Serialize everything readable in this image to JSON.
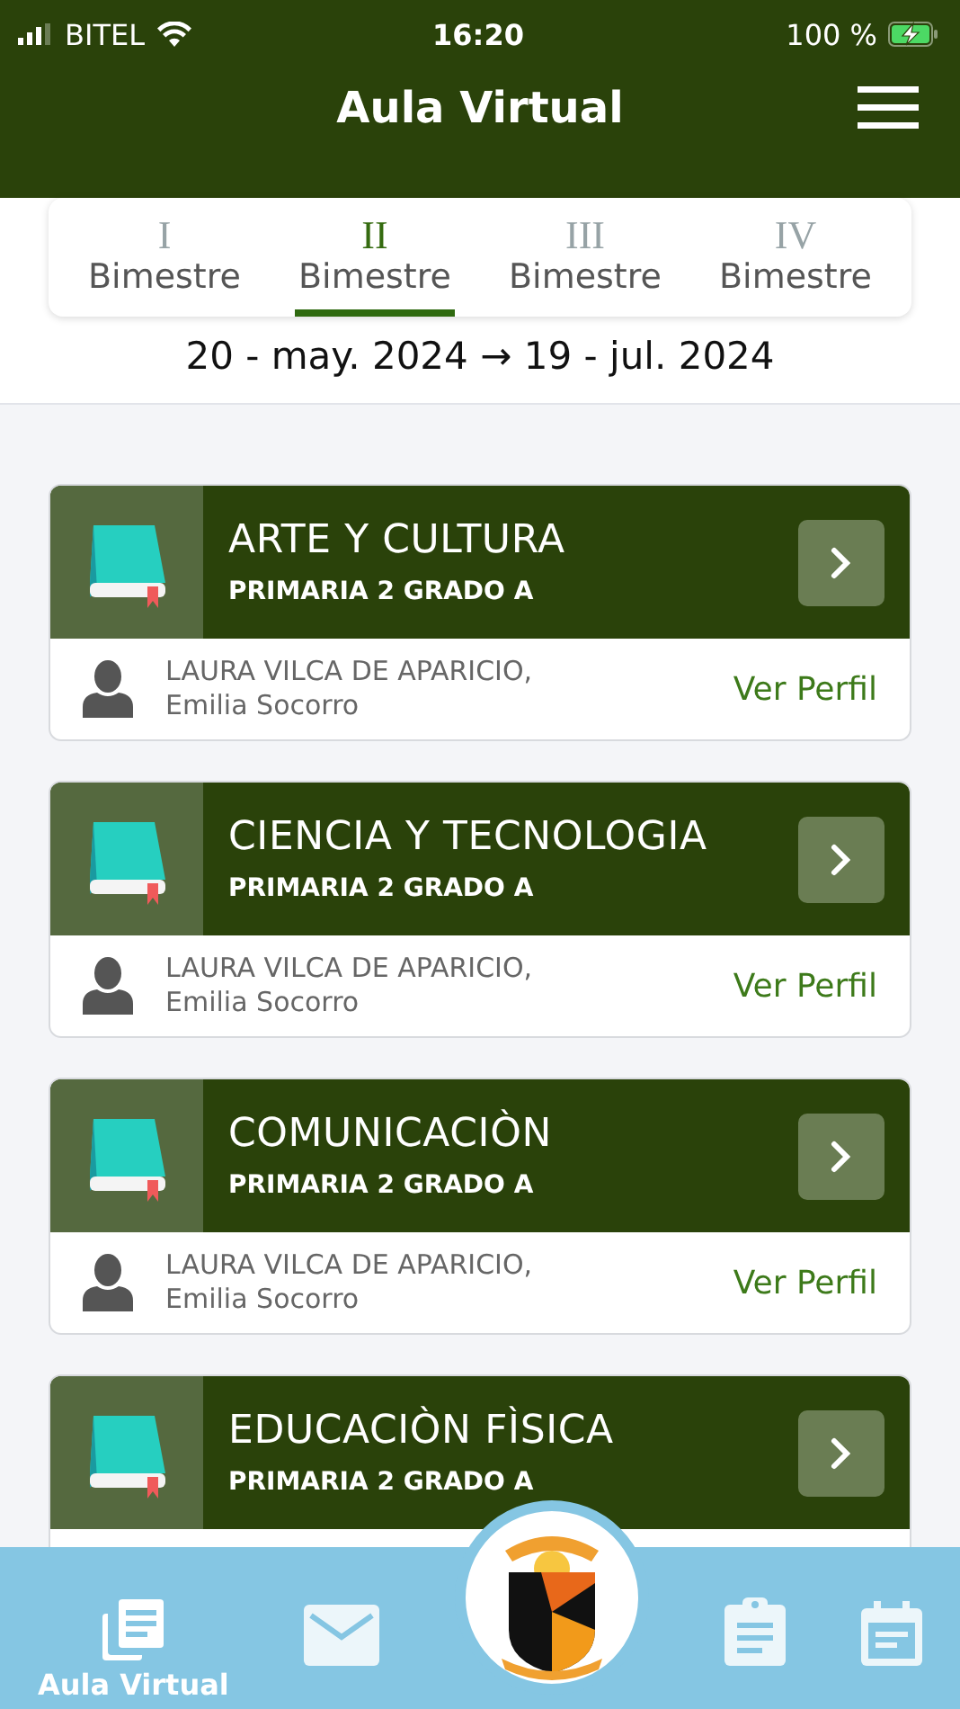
{
  "status_bar": {
    "carrier": "BITEL",
    "time": "16:20",
    "battery": "100 %"
  },
  "header": {
    "title": "Aula Virtual"
  },
  "tabs": [
    {
      "numeral": "I",
      "label": "Bimestre",
      "selected": false
    },
    {
      "numeral": "II",
      "label": "Bimestre",
      "selected": true
    },
    {
      "numeral": "III",
      "label": "Bimestre",
      "selected": false
    },
    {
      "numeral": "IV",
      "label": "Bimestre",
      "selected": false
    }
  ],
  "date_range": "20 - may. 2024 → 19 - jul. 2024",
  "courses": [
    {
      "name": "ARTE Y CULTURA",
      "group": "PRIMARIA 2 GRADO A",
      "teacher": "LAURA VILCA DE APARICIO,",
      "teacher_name": "Emilia Socorro",
      "link": "Ver Perfil"
    },
    {
      "name": "CIENCIA Y TECNOLOGIA",
      "group": "PRIMARIA 2 GRADO A",
      "teacher": "LAURA VILCA DE APARICIO,",
      "teacher_name": "Emilia Socorro",
      "link": "Ver Perfil"
    },
    {
      "name": "COMUNICACIÒN",
      "group": "PRIMARIA 2 GRADO A",
      "teacher": "LAURA VILCA DE APARICIO,",
      "teacher_name": "Emilia Socorro",
      "link": "Ver Perfil"
    },
    {
      "name": "EDUCACIÒN FÌSICA",
      "group": "PRIMARIA 2 GRADO A"
    }
  ],
  "bottom_nav": [
    {
      "kind": "docs",
      "label": "Aula Virtual",
      "selected": true
    },
    {
      "kind": "mail",
      "selected": false
    },
    {
      "kind": "logo"
    },
    {
      "kind": "clipboard",
      "selected": false
    },
    {
      "kind": "calendar",
      "selected": false
    }
  ]
}
